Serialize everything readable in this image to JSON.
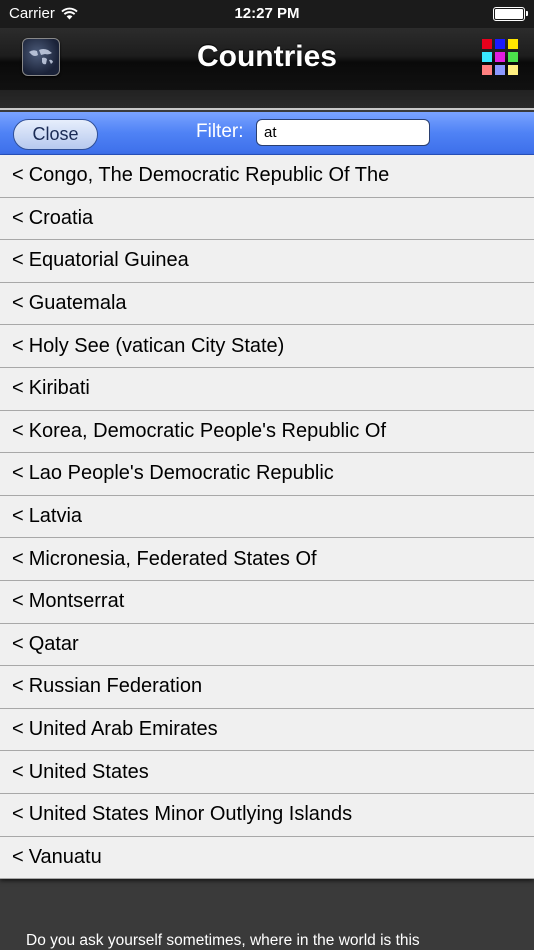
{
  "status_bar": {
    "carrier": "Carrier",
    "time": "12:27 PM"
  },
  "nav": {
    "title": "Countries",
    "left_icon": "globe-icon",
    "right_icon": "color-grid-icon",
    "grid_colors": [
      "#e8001c",
      "#1a1aff",
      "#ffe600",
      "#39e8ff",
      "#e21ee0",
      "#4ce24c",
      "#ff8080",
      "#8c98ff",
      "#ffef80"
    ]
  },
  "filter": {
    "close_label": "Close",
    "label": "Filter:",
    "value": "at"
  },
  "countries": [
    "Congo, The Democratic Republic Of The",
    "Croatia",
    "Equatorial Guinea",
    "Guatemala",
    "Holy See (vatican City State)",
    "Kiribati",
    "Korea, Democratic People's Republic Of",
    "Lao People's Democratic Republic",
    "Latvia",
    "Micronesia, Federated States Of",
    "Montserrat",
    "Qatar",
    "Russian Federation",
    "United Arab Emirates",
    "United States",
    "United States Minor Outlying Islands",
    "Vanuatu"
  ],
  "row_prefix": "<",
  "footer": {
    "text": "Do you ask yourself sometimes, where in the world is this"
  }
}
